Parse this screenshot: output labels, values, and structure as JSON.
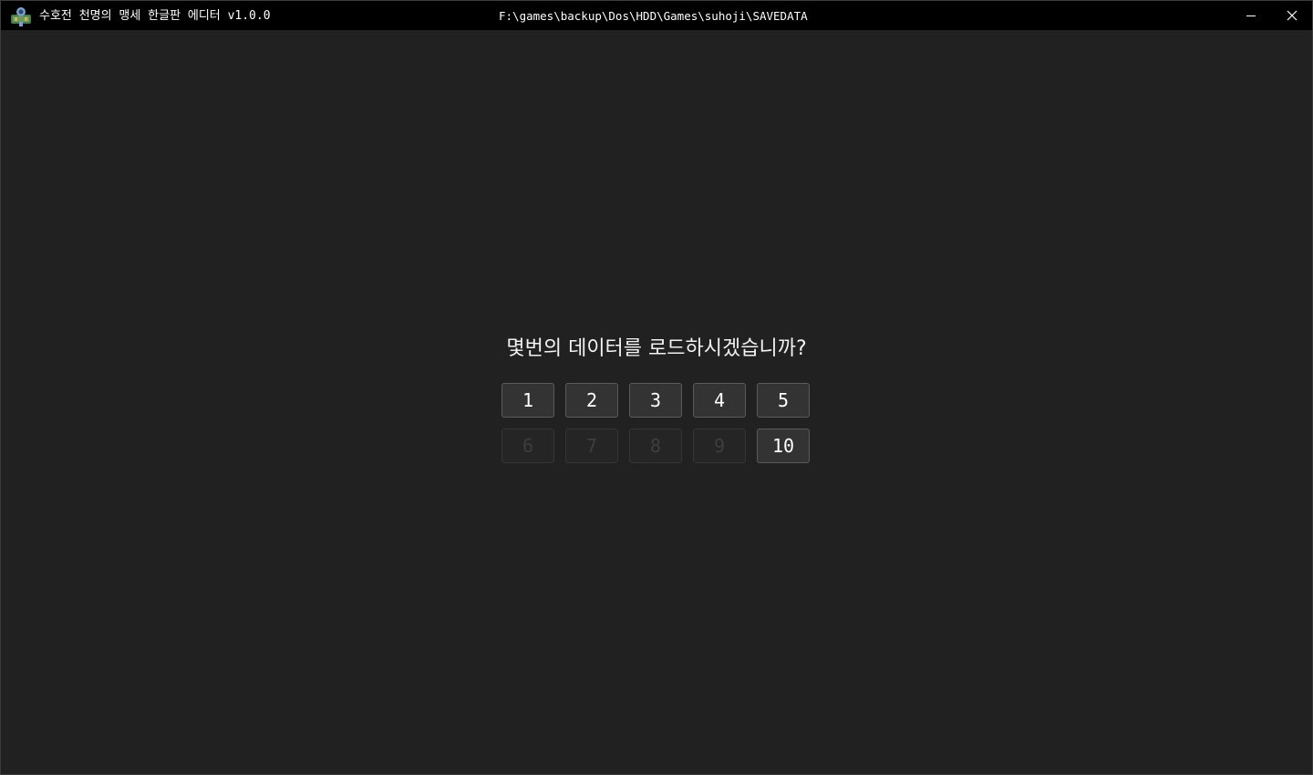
{
  "window": {
    "title": "수호전 천명의 맹세 한글판 에디터 v1.0.0",
    "path": "F:\\games\\backup\\Dos\\HDD\\Games\\suhoji\\SAVEDATA",
    "icons": {
      "app": "app-icon",
      "minimize": "minimize-icon",
      "close": "close-icon"
    }
  },
  "dialog": {
    "prompt": "몇번의 데이터를 로드하시겠습니까?",
    "slots": [
      {
        "label": "1",
        "enabled": true
      },
      {
        "label": "2",
        "enabled": true
      },
      {
        "label": "3",
        "enabled": true
      },
      {
        "label": "4",
        "enabled": true
      },
      {
        "label": "5",
        "enabled": true
      },
      {
        "label": "6",
        "enabled": false
      },
      {
        "label": "7",
        "enabled": false
      },
      {
        "label": "8",
        "enabled": false
      },
      {
        "label": "9",
        "enabled": false
      },
      {
        "label": "10",
        "enabled": true
      }
    ]
  },
  "colors": {
    "background": "#212121",
    "titlebar": "#000000",
    "button": "#333333",
    "button_disabled": "#252525"
  }
}
